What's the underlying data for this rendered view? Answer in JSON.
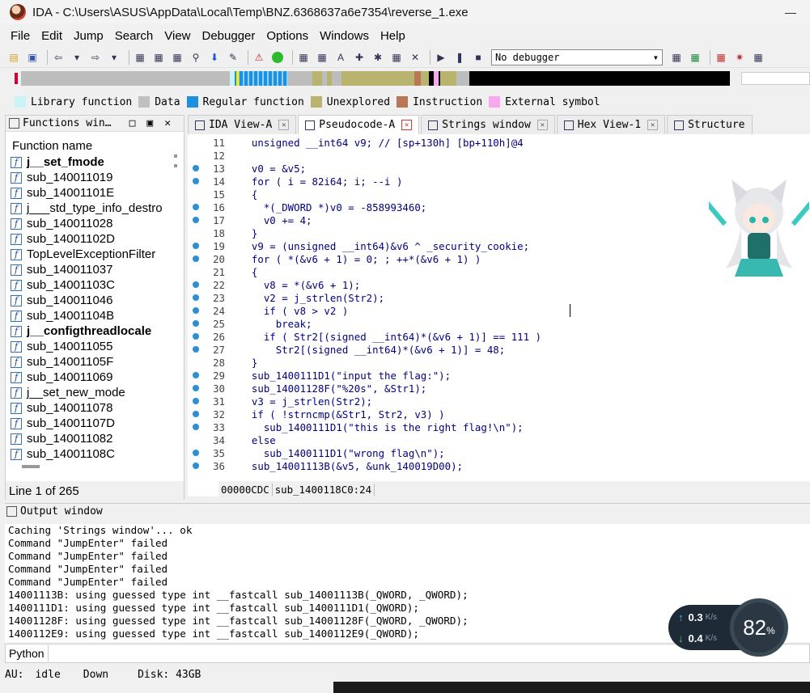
{
  "window": {
    "title": "IDA - C:\\Users\\ASUS\\AppData\\Local\\Temp\\BNZ.6368637a6e7354\\reverse_1.exe",
    "minimize": "—",
    "maximize": "☐"
  },
  "menu": [
    "File",
    "Edit",
    "Jump",
    "Search",
    "View",
    "Debugger",
    "Options",
    "Windows",
    "Help"
  ],
  "toolbar": {
    "debugger_value": "No debugger"
  },
  "legend": [
    {
      "label": "Library function",
      "color": "#c8f4f7"
    },
    {
      "label": "Data",
      "color": "#c0c0c0"
    },
    {
      "label": "Regular function",
      "color": "#1e90e0"
    },
    {
      "label": "Unexplored",
      "color": "#b8b470"
    },
    {
      "label": "Instruction",
      "color": "#b87858"
    },
    {
      "label": "External symbol",
      "color": "#f7a8f0"
    }
  ],
  "functions_panel": {
    "title": "Functions win…",
    "column": "Function name",
    "items": [
      {
        "name": "j__set_fmode",
        "bold": true
      },
      {
        "name": "sub_140011019",
        "bold": false
      },
      {
        "name": "sub_14001101E",
        "bold": false
      },
      {
        "name": "j___std_type_info_destro",
        "bold": false
      },
      {
        "name": "sub_140011028",
        "bold": false
      },
      {
        "name": "sub_14001102D",
        "bold": false
      },
      {
        "name": "TopLevelExceptionFilter",
        "bold": false
      },
      {
        "name": "sub_140011037",
        "bold": false
      },
      {
        "name": "sub_14001103C",
        "bold": false
      },
      {
        "name": "sub_140011046",
        "bold": false
      },
      {
        "name": "sub_14001104B",
        "bold": false
      },
      {
        "name": "j__configthreadlocale",
        "bold": true
      },
      {
        "name": "sub_140011055",
        "bold": false
      },
      {
        "name": "sub_14001105F",
        "bold": false
      },
      {
        "name": "sub_140011069",
        "bold": false
      },
      {
        "name": "j__set_new_mode",
        "bold": false
      },
      {
        "name": "sub_140011078",
        "bold": false
      },
      {
        "name": "sub_14001107D",
        "bold": false
      },
      {
        "name": "sub_140011082",
        "bold": false
      },
      {
        "name": "sub_14001108C",
        "bold": false
      }
    ],
    "status": "Line 1 of 265"
  },
  "tabs": [
    {
      "label": "IDA View-A",
      "active": false,
      "icon": "ida-view-icon"
    },
    {
      "label": "Pseudocode-A",
      "active": true,
      "icon": "pseudocode-icon"
    },
    {
      "label": "Strings window",
      "active": false,
      "icon": "strings-icon"
    },
    {
      "label": "Hex View-1",
      "active": false,
      "icon": "hex-icon"
    },
    {
      "label": "Structure",
      "active": false,
      "icon": "structure-icon"
    }
  ],
  "code_lines": [
    {
      "ln": "11",
      "bp": false,
      "text": "  unsigned __int64 v9; // [sp+130h] [bp+110h]@4"
    },
    {
      "ln": "12",
      "bp": false,
      "text": ""
    },
    {
      "ln": "13",
      "bp": true,
      "text": "  v0 = &v5;"
    },
    {
      "ln": "14",
      "bp": true,
      "text": "  for ( i = 82i64; i; --i )"
    },
    {
      "ln": "15",
      "bp": false,
      "text": "  {"
    },
    {
      "ln": "16",
      "bp": true,
      "text": "    *(_DWORD *)v0 = -858993460;"
    },
    {
      "ln": "17",
      "bp": true,
      "text": "    v0 += 4;"
    },
    {
      "ln": "18",
      "bp": false,
      "text": "  }"
    },
    {
      "ln": "19",
      "bp": true,
      "text": "  v9 = (unsigned __int64)&v6 ^ _security_cookie;"
    },
    {
      "ln": "20",
      "bp": true,
      "text": "  for ( *(&v6 + 1) = 0; ; ++*(&v6 + 1) )"
    },
    {
      "ln": "21",
      "bp": false,
      "text": "  {"
    },
    {
      "ln": "22",
      "bp": true,
      "text": "    v8 = *(&v6 + 1);"
    },
    {
      "ln": "23",
      "bp": true,
      "text": "    v2 = j_strlen(Str2);"
    },
    {
      "ln": "24",
      "bp": true,
      "text": "    if ( v8 > v2 )"
    },
    {
      "ln": "25",
      "bp": true,
      "text": "      break;"
    },
    {
      "ln": "26",
      "bp": true,
      "text": "    if ( Str2[(signed __int64)*(&v6 + 1)] == 111 )"
    },
    {
      "ln": "27",
      "bp": true,
      "text": "      Str2[(signed __int64)*(&v6 + 1)] = 48;"
    },
    {
      "ln": "28",
      "bp": false,
      "text": "  }"
    },
    {
      "ln": "29",
      "bp": true,
      "text": "  sub_1400111D1(\"input the flag:\");"
    },
    {
      "ln": "30",
      "bp": true,
      "text": "  sub_14001128F(\"%20s\", &Str1);"
    },
    {
      "ln": "31",
      "bp": true,
      "text": "  v3 = j_strlen(Str2);"
    },
    {
      "ln": "32",
      "bp": true,
      "text": "  if ( !strncmp(&Str1, Str2, v3) )"
    },
    {
      "ln": "33",
      "bp": true,
      "text": "    sub_1400111D1(\"this is the right flag!\\n\");"
    },
    {
      "ln": "34",
      "bp": false,
      "text": "  else"
    },
    {
      "ln": "35",
      "bp": true,
      "text": "    sub_1400111D1(\"wrong flag\\n\");"
    },
    {
      "ln": "36",
      "bp": true,
      "text": "  sub_14001113B(&v5, &unk_140019D00);"
    }
  ],
  "code_status": {
    "address": "00000CDC",
    "location": "sub_1400118C0:24"
  },
  "output": {
    "title": "Output window",
    "lines": [
      "Caching 'Strings window'... ok",
      "Command \"JumpEnter\" failed",
      "Command \"JumpEnter\" failed",
      "Command \"JumpEnter\" failed",
      "Command \"JumpEnter\" failed",
      "14001113B: using guessed type int __fastcall sub_14001113B(_QWORD, _QWORD);",
      "1400111D1: using guessed type int __fastcall sub_1400111D1(_QWORD);",
      "14001128F: using guessed type int __fastcall sub_14001128F(_QWORD, _QWORD);",
      "1400112E9: using guessed type int __fastcall sub_1400112E9(_QWORD);"
    ]
  },
  "python_button": "Python",
  "statusbar": {
    "au_label": "AU:",
    "au_value": "idle",
    "direction": "Down",
    "disk": "Disk: 43GB"
  },
  "net_widget": {
    "up": "0.3",
    "down": "0.4",
    "unit": "K/s",
    "percent": "82",
    "percent_sign": "%"
  }
}
